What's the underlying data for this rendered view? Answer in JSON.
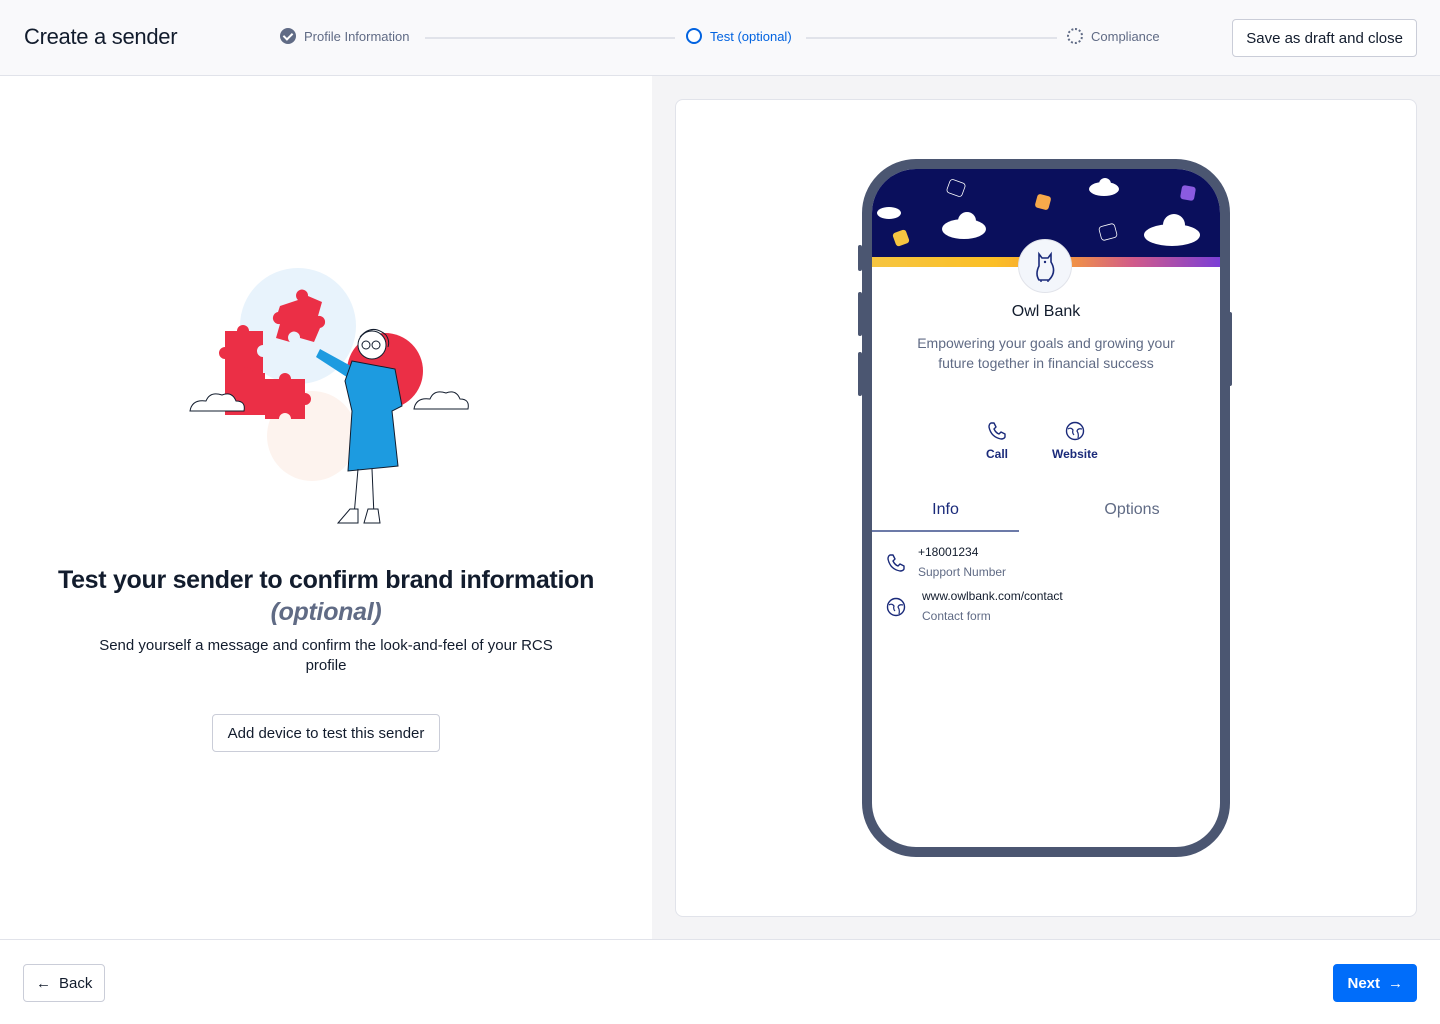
{
  "header": {
    "title": "Create a sender",
    "steps": [
      {
        "label": "Profile Information",
        "state": "complete",
        "icon": "check-circle-icon"
      },
      {
        "label": "Test (optional)",
        "state": "current",
        "icon": "current-step-circle-icon"
      },
      {
        "label": "Compliance",
        "state": "pending",
        "icon": "pending-step-dotted-circle-icon"
      }
    ],
    "draft_button": "Save as draft and close"
  },
  "left": {
    "illustration": "woman-assembling-puzzle-illustration",
    "heading": "Test your sender to confirm brand information",
    "heading_optional": "(optional)",
    "subtext": "Send yourself a message and confirm the look-and-feel of your RCS profile",
    "add_device_button": "Add device to test this sender"
  },
  "preview": {
    "brand_name": "Owl Bank",
    "brand_description": "Empowering your goals and growing your future together in financial success",
    "logo_icon": "owl-icon",
    "actions": [
      {
        "label": "Call",
        "icon": "phone-icon"
      },
      {
        "label": "Website",
        "icon": "globe-icon"
      }
    ],
    "tabs": [
      {
        "label": "Info",
        "active": true
      },
      {
        "label": "Options",
        "active": false
      }
    ],
    "info_items": [
      {
        "value": "+18001234",
        "caption": "Support Number",
        "icon": "phone-icon"
      },
      {
        "value": "www.owlbank.com/contact",
        "caption": "Contact form",
        "icon": "globe-icon"
      }
    ]
  },
  "footer": {
    "back_button": "Back",
    "next_button": "Next"
  },
  "colors": {
    "primary": "#006dfa",
    "current_step": "#0263e0",
    "phone_frame": "#4b5671",
    "banner": "#0a0f5c",
    "preview_accent": "#1a2a7a"
  }
}
